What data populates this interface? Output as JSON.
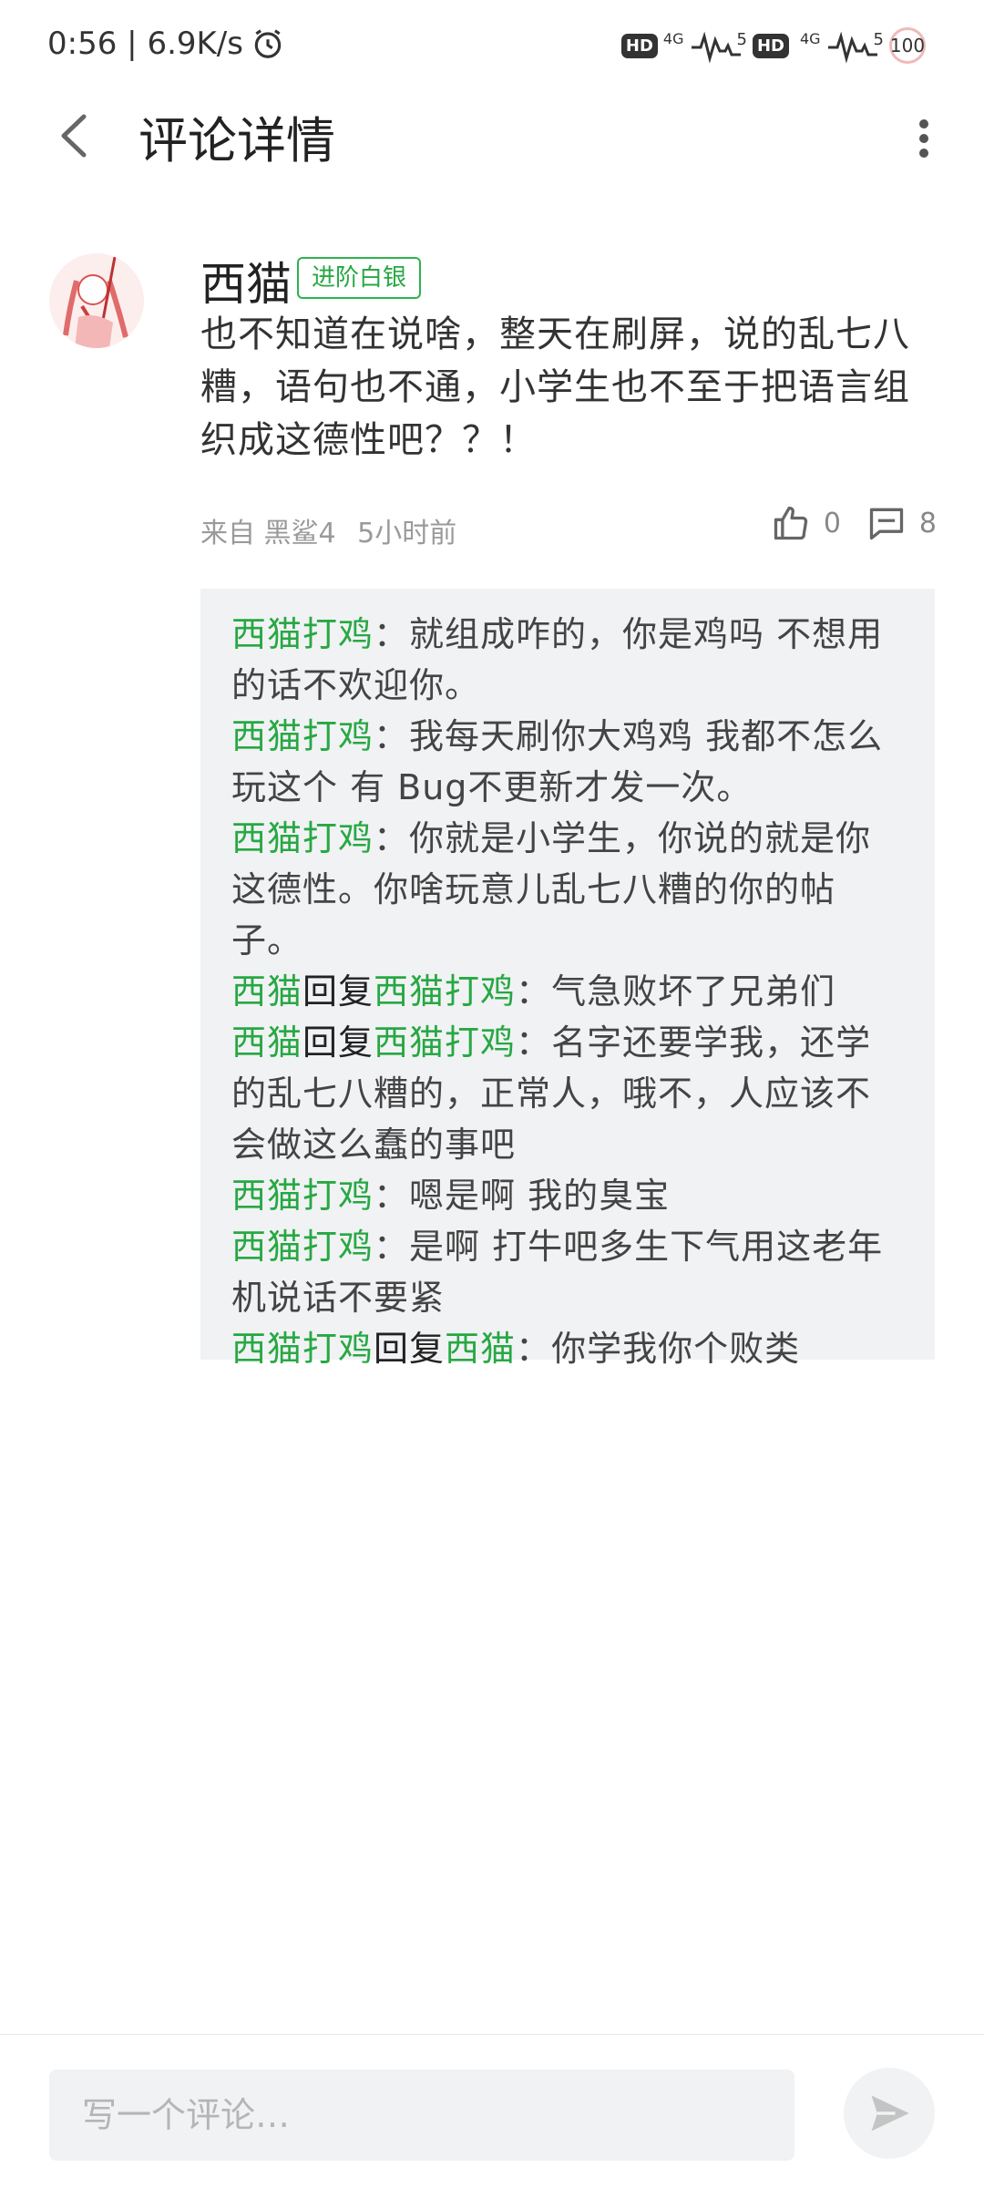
{
  "status_bar": {
    "time": "0:56",
    "speed": "6.9K/s",
    "hd1": "HD",
    "hd2": "HD",
    "net1": "4G",
    "net2": "4G",
    "sig1": "5",
    "sig2": "5",
    "battery": "100"
  },
  "header": {
    "title": "评论详情"
  },
  "comment": {
    "user": "西猫",
    "badge": "进阶白银",
    "text": "也不知道在说啥，整天在刷屏，说的乱七八糟，语句也不通，小学生也不至于把语言组织成这德性吧？？！",
    "device": "来自 黑鲨4",
    "time": "5小时前",
    "likes": "0",
    "replies_count": "8"
  },
  "replies": [
    {
      "from": "西猫打鸡",
      "to": "",
      "text": "就组成咋的，你是鸡吗 不想用的话不欢迎你。"
    },
    {
      "from": "西猫打鸡",
      "to": "",
      "text": "我每天刷你大鸡鸡 我都不怎么玩这个 有 Bug不更新才发一次。"
    },
    {
      "from": "西猫打鸡",
      "to": "",
      "text": "你就是小学生，你说的就是你这德性。你啥玩意儿乱七八糟的你的帖子。"
    },
    {
      "from": "西猫",
      "to": "西猫打鸡",
      "text": "气急败坏了兄弟们"
    },
    {
      "from": "西猫",
      "to": "西猫打鸡",
      "text": "名字还要学我，还学的乱七八糟的，正常人，哦不，人应该不会做这么蠢的事吧"
    },
    {
      "from": "西猫打鸡",
      "to": "",
      "text": "嗯是啊   我的臭宝"
    },
    {
      "from": "西猫打鸡",
      "to": "",
      "text": "是啊  打牛吧多生下气用这老年机说话不要紧"
    },
    {
      "from": "西猫打鸡",
      "to": "西猫",
      "text": "你学我你个败类"
    }
  ],
  "labels": {
    "reply_word": "回复",
    "colon": "："
  },
  "composer": {
    "placeholder": "写一个评论…"
  },
  "colors": {
    "username_green": "#27a843",
    "reply_bg": "#f1f2f4"
  },
  "icons": [
    "back-arrow-icon",
    "more-vertical-icon",
    "thumbs-up-icon",
    "comment-icon",
    "send-icon",
    "alarm-icon"
  ]
}
